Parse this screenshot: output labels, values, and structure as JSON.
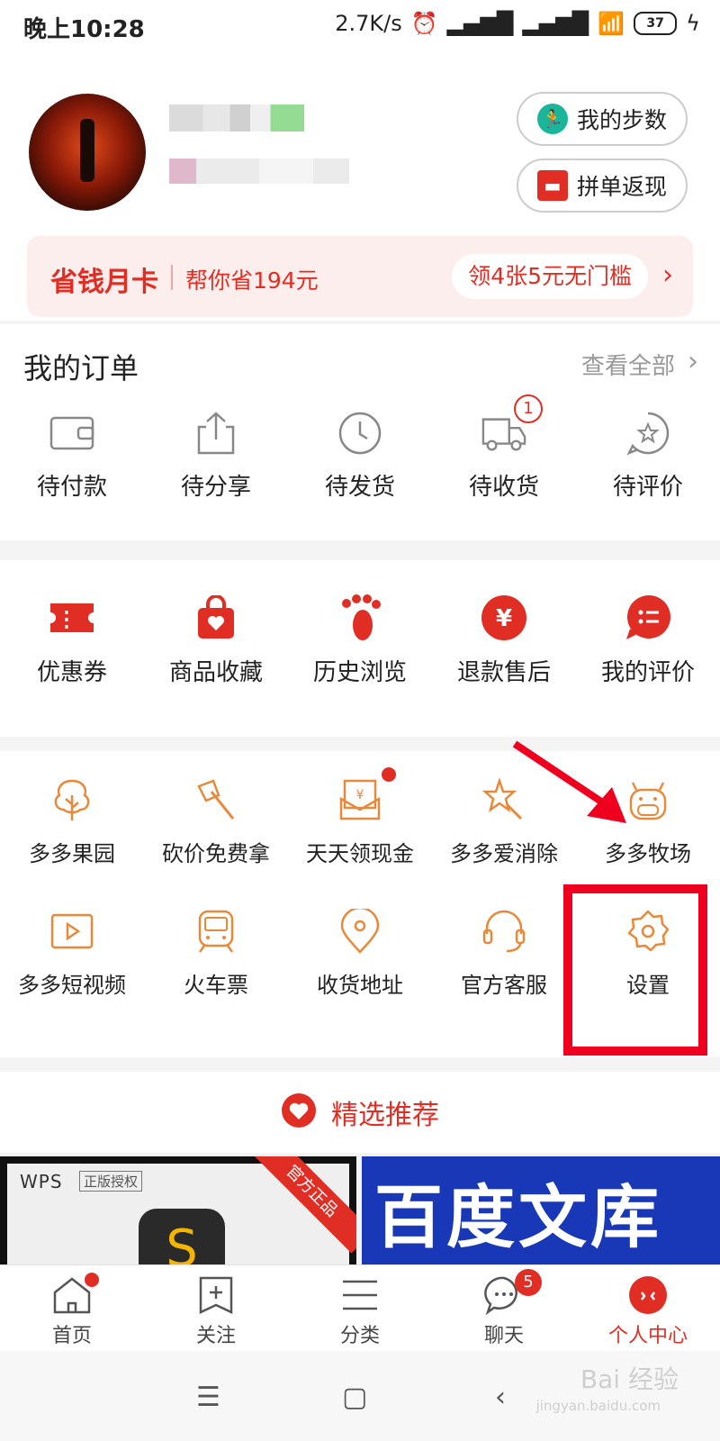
{
  "status_bar": {
    "time": "晚上10:28",
    "speed": "2.7K/s",
    "battery": "37"
  },
  "profile": {
    "steps_label": "我的步数",
    "group_refund_label": "拼单返现"
  },
  "savings_card": {
    "title": "省钱月卡",
    "subtitle": "帮你省194元",
    "coupon": "领4张5元无门槛"
  },
  "orders": {
    "title": "我的订单",
    "view_all": "查看全部",
    "items": [
      {
        "label": "待付款",
        "icon": "wallet-icon"
      },
      {
        "label": "待分享",
        "icon": "share-icon"
      },
      {
        "label": "待发货",
        "icon": "clock-icon"
      },
      {
        "label": "待收货",
        "icon": "truck-icon",
        "badge": "1"
      },
      {
        "label": "待评价",
        "icon": "star-bubble-icon"
      }
    ]
  },
  "tools": [
    {
      "label": "优惠券",
      "icon": "ticket-icon"
    },
    {
      "label": "商品收藏",
      "icon": "bag-heart-icon"
    },
    {
      "label": "历史浏览",
      "icon": "footprint-icon"
    },
    {
      "label": "退款售后",
      "icon": "yen-icon"
    },
    {
      "label": "我的评价",
      "icon": "comment-icon"
    }
  ],
  "services_row1": [
    {
      "label": "多多果园",
      "icon": "tree-icon"
    },
    {
      "label": "砍价免费拿",
      "icon": "axe-icon"
    },
    {
      "label": "天天领现金",
      "icon": "cash-envelope-icon"
    },
    {
      "label": "多多爱消除",
      "icon": "star-wand-icon"
    },
    {
      "label": "多多牧场",
      "icon": "cow-icon"
    }
  ],
  "services_row2": [
    {
      "label": "多多短视频",
      "icon": "video-icon"
    },
    {
      "label": "火车票",
      "icon": "train-icon"
    },
    {
      "label": "收货地址",
      "icon": "location-icon"
    },
    {
      "label": "官方客服",
      "icon": "headset-icon"
    },
    {
      "label": "设置",
      "icon": "gear-icon"
    }
  ],
  "recommend": {
    "title": "精选推荐"
  },
  "banners": {
    "wps_logo": "WPS",
    "wps_auth": "正版授权",
    "wps_ribbon": "官方正品",
    "baidu": "百度文库"
  },
  "tabbar": [
    {
      "label": "首页",
      "icon": "home-icon"
    },
    {
      "label": "关注",
      "icon": "follow-icon"
    },
    {
      "label": "分类",
      "icon": "category-icon"
    },
    {
      "label": "聊天",
      "icon": "chat-icon",
      "badge": "5"
    },
    {
      "label": "个人中心",
      "icon": "profile-icon",
      "active": true
    }
  ],
  "watermark": {
    "main": "Bai 经验",
    "sub": "jingyan.baidu.com"
  },
  "colors": {
    "accent": "#e02e24",
    "orange": "#e8893a",
    "annotation": "#f0001f"
  }
}
